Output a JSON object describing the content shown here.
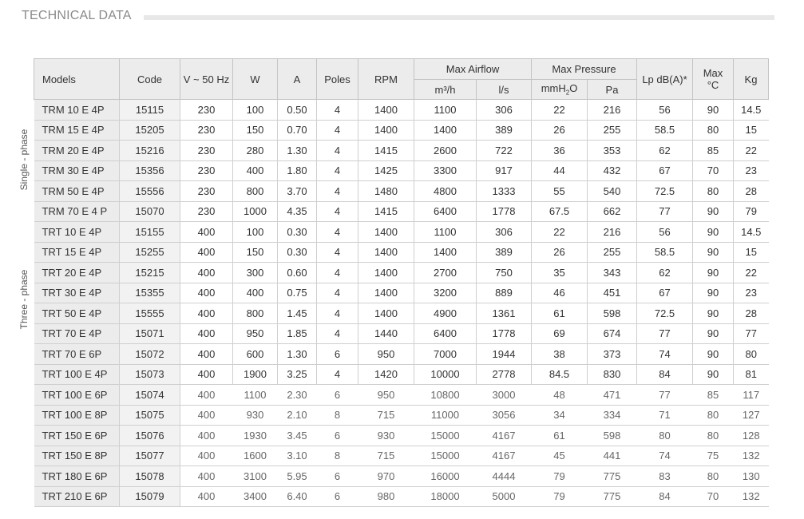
{
  "title": "TECHNICAL DATA",
  "side_labels": {
    "single": "Single - phase",
    "three": "Three - phase"
  },
  "headers": {
    "models": "Models",
    "code": "Code",
    "voltage": "V ~ 50 Hz",
    "watts": "W",
    "amps": "A",
    "poles": "Poles",
    "rpm": "RPM",
    "max_airflow": "Max Airflow",
    "airflow_m3h": "m³/h",
    "airflow_ls": "l/s",
    "max_pressure": "Max Pressure",
    "pressure_mmh2o_prefix": "mmH",
    "pressure_mmh2o_sub": "2",
    "pressure_mmh2o_suffix": "O",
    "pressure_pa": "Pa",
    "lp": "Lp dB(A)*",
    "max_temp_line1": "Max",
    "max_temp_line2": "°C",
    "kg": "Kg"
  },
  "rows": [
    [
      "TRM 10 E 4P",
      "15115",
      "230",
      "100",
      "0.50",
      "4",
      "1400",
      "1100",
      "306",
      "22",
      "216",
      "56",
      "90",
      "14.5"
    ],
    [
      "TRM 15 E 4P",
      "15205",
      "230",
      "150",
      "0.70",
      "4",
      "1400",
      "1400",
      "389",
      "26",
      "255",
      "58.5",
      "80",
      "15"
    ],
    [
      "TRM 20 E 4P",
      "15216",
      "230",
      "280",
      "1.30",
      "4",
      "1415",
      "2600",
      "722",
      "36",
      "353",
      "62",
      "85",
      "22"
    ],
    [
      "TRM 30 E 4P",
      "15356",
      "230",
      "400",
      "1.80",
      "4",
      "1425",
      "3300",
      "917",
      "44",
      "432",
      "67",
      "70",
      "23"
    ],
    [
      "TRM 50 E 4P",
      "15556",
      "230",
      "800",
      "3.70",
      "4",
      "1480",
      "4800",
      "1333",
      "55",
      "540",
      "72.5",
      "80",
      "28"
    ],
    [
      "TRM 70 E 4 P",
      "15070",
      "230",
      "1000",
      "4.35",
      "4",
      "1415",
      "6400",
      "1778",
      "67.5",
      "662",
      "77",
      "90",
      "79"
    ],
    [
      "TRT 10 E 4P",
      "15155",
      "400",
      "100",
      "0.30",
      "4",
      "1400",
      "1100",
      "306",
      "22",
      "216",
      "56",
      "90",
      "14.5"
    ],
    [
      "TRT 15 E 4P",
      "15255",
      "400",
      "150",
      "0.30",
      "4",
      "1400",
      "1400",
      "389",
      "26",
      "255",
      "58.5",
      "90",
      "15"
    ],
    [
      "TRT 20 E 4P",
      "15215",
      "400",
      "300",
      "0.60",
      "4",
      "1400",
      "2700",
      "750",
      "35",
      "343",
      "62",
      "90",
      "22"
    ],
    [
      "TRT 30 E 4P",
      "15355",
      "400",
      "400",
      "0.75",
      "4",
      "1400",
      "3200",
      "889",
      "46",
      "451",
      "67",
      "90",
      "23"
    ],
    [
      "TRT 50 E 4P",
      "15555",
      "400",
      "800",
      "1.45",
      "4",
      "1400",
      "4900",
      "1361",
      "61",
      "598",
      "72.5",
      "90",
      "28"
    ],
    [
      "TRT 70 E 4P",
      "15071",
      "400",
      "950",
      "1.85",
      "4",
      "1440",
      "6400",
      "1778",
      "69",
      "674",
      "77",
      "90",
      "77"
    ],
    [
      "TRT 70 E 6P",
      "15072",
      "400",
      "600",
      "1.30",
      "6",
      "950",
      "7000",
      "1944",
      "38",
      "373",
      "74",
      "90",
      "80"
    ],
    [
      "TRT 100 E 4P",
      "15073",
      "400",
      "1900",
      "3.25",
      "4",
      "1420",
      "10000",
      "2778",
      "84.5",
      "830",
      "84",
      "90",
      "81"
    ],
    [
      "TRT 100 E 6P",
      "15074",
      "400",
      "1100",
      "2.30",
      "6",
      "950",
      "10800",
      "3000",
      "48",
      "471",
      "77",
      "85",
      "117"
    ],
    [
      "TRT 100 E 8P",
      "15075",
      "400",
      "930",
      "2.10",
      "8",
      "715",
      "11000",
      "3056",
      "34",
      "334",
      "71",
      "80",
      "127"
    ],
    [
      "TRT 150 E 6P",
      "15076",
      "400",
      "1930",
      "3.45",
      "6",
      "930",
      "15000",
      "4167",
      "61",
      "598",
      "80",
      "80",
      "128"
    ],
    [
      "TRT 150 E 8P",
      "15077",
      "400",
      "1600",
      "3.10",
      "8",
      "715",
      "15000",
      "4167",
      "45",
      "441",
      "74",
      "75",
      "132"
    ],
    [
      "TRT 180 E 6P",
      "15078",
      "400",
      "3100",
      "5.95",
      "6",
      "970",
      "16000",
      "4444",
      "79",
      "775",
      "83",
      "80",
      "130"
    ],
    [
      "TRT 210 E 6P",
      "15079",
      "400",
      "3400",
      "6.40",
      "6",
      "980",
      "18000",
      "5000",
      "79",
      "775",
      "84",
      "70",
      "132"
    ]
  ]
}
